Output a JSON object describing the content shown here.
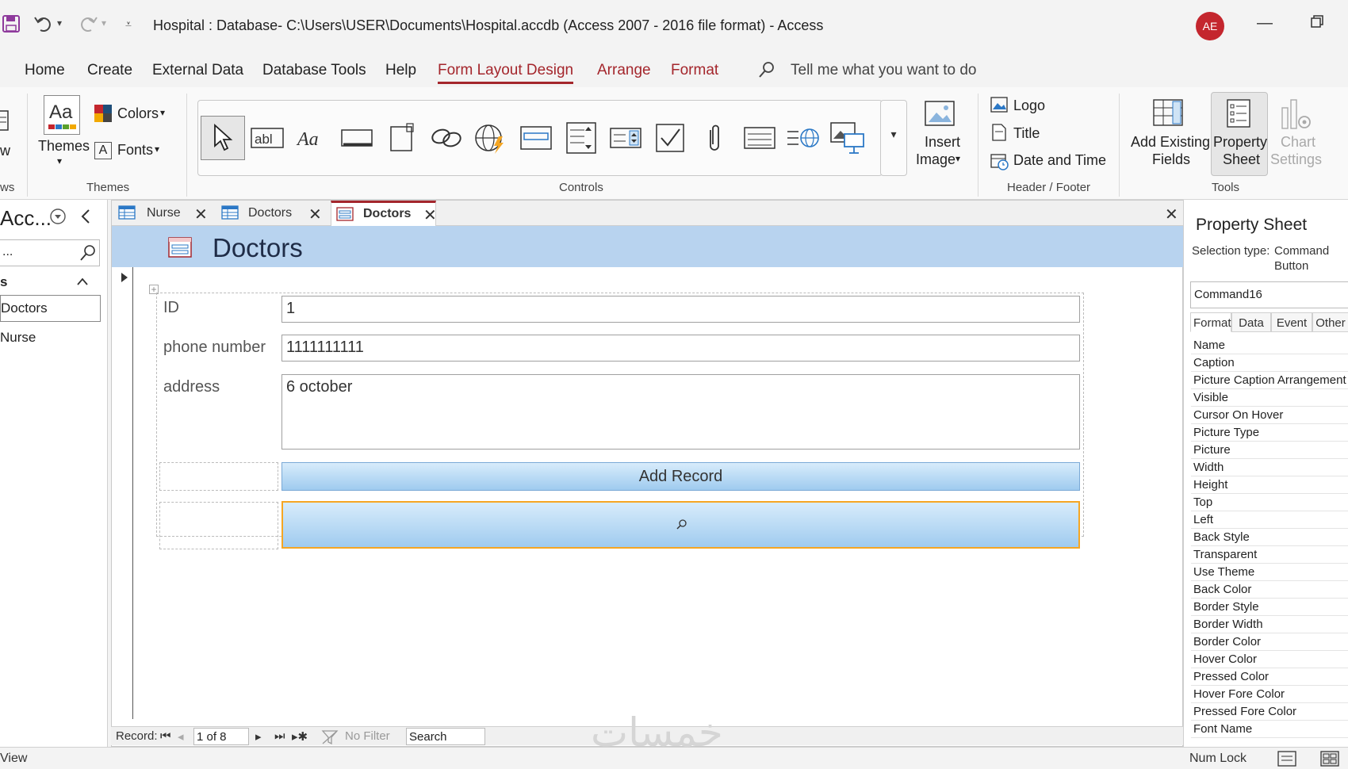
{
  "titlebar": {
    "title": "Hospital : Database- C:\\Users\\USER\\Documents\\Hospital.accdb (Access 2007 - 2016 file format)  -  Access",
    "avatar_initials": "AE"
  },
  "menu": {
    "tabs": [
      "Home",
      "Create",
      "External Data",
      "Database Tools",
      "Help",
      "Form Layout Design",
      "Arrange",
      "Format"
    ],
    "tellme": "Tell me what you want to do"
  },
  "ribbon": {
    "views_label_fragment": "ws",
    "view_fragment": "w",
    "themes": {
      "themes_btn": "Themes",
      "colors": "Colors",
      "fonts": "Fonts",
      "group": "Themes"
    },
    "controls": {
      "group": "Controls"
    },
    "insert_image": [
      "Insert",
      "Image"
    ],
    "header_footer": {
      "logo": "Logo",
      "title": "Title",
      "date_time": "Date and Time",
      "group": "Header / Footer"
    },
    "tools": {
      "add_existing": [
        "Add Existing",
        "Fields"
      ],
      "property_sheet": [
        "Property",
        "Sheet"
      ],
      "chart_settings": [
        "Chart",
        "Settings"
      ],
      "group": "Tools"
    }
  },
  "navpane": {
    "title": "Acc...",
    "search_value": "...",
    "section_fragment": "s",
    "items": [
      "Doctors",
      "Nurse"
    ]
  },
  "doctabs": [
    {
      "label": "Nurse"
    },
    {
      "label": "Doctors"
    },
    {
      "label": "Doctors"
    }
  ],
  "form": {
    "title": "Doctors",
    "fields": [
      {
        "label": "ID",
        "value": "1"
      },
      {
        "label": "phone number",
        "value": "1111111111"
      },
      {
        "label": "address",
        "value": "6 october"
      }
    ],
    "add_record_button": "Add Record"
  },
  "record_nav": {
    "label": "Record:",
    "position": "1 of 8",
    "filter": "No Filter",
    "search": "Search"
  },
  "property_sheet": {
    "title": "Property Sheet",
    "selection_type_label": "Selection type:",
    "selection_type_value": [
      "Command",
      "Button"
    ],
    "object_name": "Command16",
    "tabs": [
      "Format",
      "Data",
      "Event",
      "Other"
    ],
    "properties": [
      "Name",
      "Caption",
      "Picture Caption Arrangement",
      "Visible",
      "Cursor On Hover",
      "Picture Type",
      "Picture",
      "Width",
      "Height",
      "Top",
      "Left",
      "Back Style",
      "Transparent",
      "Use Theme",
      "Back Color",
      "Border Style",
      "Border Width",
      "Border Color",
      "Hover Color",
      "Pressed Color",
      "Hover Fore Color",
      "Pressed Fore Color",
      "Font Name"
    ]
  },
  "statusbar": {
    "left": "View",
    "num_lock": "Num Lock"
  },
  "watermark": "خمسات",
  "colors": {
    "accent": "#a4262c",
    "form_header": "#b8d3ef",
    "selected_border": "#f5a623"
  }
}
